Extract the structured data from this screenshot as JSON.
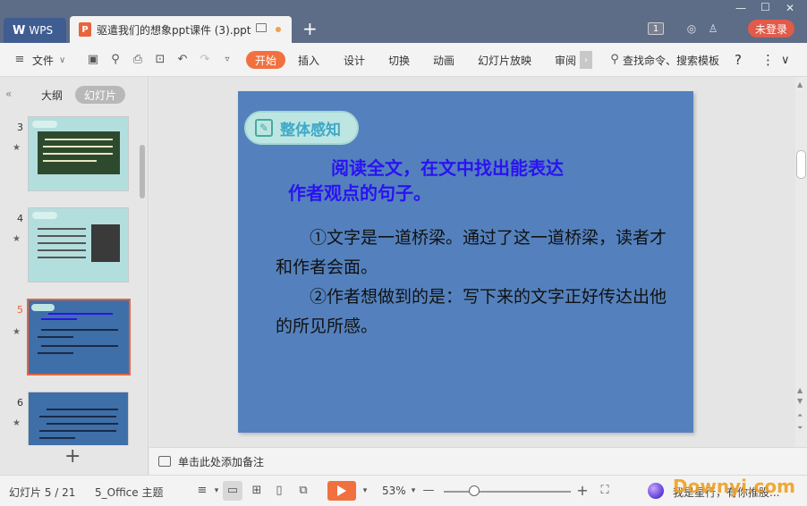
{
  "titlebar": {
    "wps_tab": "WPS",
    "doc_tab": "驱遣我们的想象ppt课件 (3).ppt",
    "new_tab": "+",
    "badge": "1",
    "login": "未登录"
  },
  "toolbar": {
    "file_menu": "文件",
    "tabs": [
      "开始",
      "插入",
      "设计",
      "切换",
      "动画",
      "幻灯片放映",
      "审阅"
    ],
    "search": "查找命令、搜索模板",
    "help": "?"
  },
  "left_panel": {
    "tab_outline": "大纲",
    "tab_slides": "幻灯片",
    "thumbnails": [
      {
        "num": "3"
      },
      {
        "num": "4"
      },
      {
        "num": "5"
      },
      {
        "num": "6"
      }
    ]
  },
  "slide": {
    "badge_text": "整体感知",
    "heading_line1": "阅读全文，在文中找出能表达",
    "heading_line2": "作者观点的句子。",
    "para1": "①文字是一道桥梁。通过了这一道桥梁，读者才和作者会面。",
    "para2": "②作者想做到的是：写下来的文字正好传达出他的所见所感。"
  },
  "notes": {
    "placeholder": "单击此处添加备注"
  },
  "statusbar": {
    "slide_count": "幻灯片 5 / 21",
    "theme": "5_Office 主题",
    "zoom": "53%",
    "ai_text": "我是星行，有你推股..."
  },
  "watermark": "Downyi.com",
  "colors": {
    "accent": "#f0713f",
    "slide_bg": "#5481bd",
    "heading": "#2a13f0",
    "titlebar": "#5d6c87"
  }
}
